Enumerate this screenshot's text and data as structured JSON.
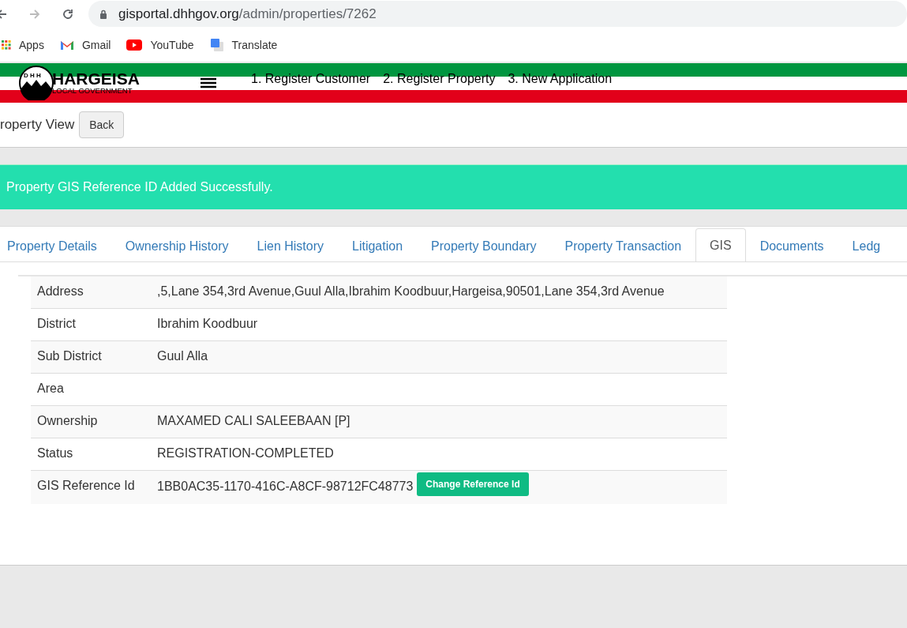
{
  "browser": {
    "url_host": "gisportal.dhhgov.org",
    "url_path": "/admin/properties/7262",
    "bookmarks": [
      {
        "label": "Apps",
        "kind": "apps"
      },
      {
        "label": "Gmail",
        "kind": "gmail"
      },
      {
        "label": "YouTube",
        "kind": "youtube"
      },
      {
        "label": "Translate",
        "kind": "translate"
      }
    ]
  },
  "header": {
    "logo_title": "HARGEISA",
    "logo_subtitle": "LOCAL GOVERNMENT",
    "logo_letters": "D H H",
    "nav": [
      "1. Register Customer",
      "2. Register Property",
      "3. New Application"
    ]
  },
  "page": {
    "title": "roperty View",
    "back_button": "Back"
  },
  "alert": "Property GIS Reference ID Added Successfully.",
  "tabs": [
    {
      "label": "Property Details",
      "selected": false
    },
    {
      "label": "Ownership History",
      "selected": false
    },
    {
      "label": "Lien History",
      "selected": false
    },
    {
      "label": "Litigation",
      "selected": false
    },
    {
      "label": "Property Boundary",
      "selected": false
    },
    {
      "label": "Property Transaction",
      "selected": false
    },
    {
      "label": "GIS",
      "selected": true
    },
    {
      "label": "Documents",
      "selected": false
    },
    {
      "label": "Ledg",
      "selected": false
    }
  ],
  "details": [
    {
      "label": "Address",
      "value": ",5,Lane 354,3rd Avenue,Guul Alla,Ibrahim Koodbuur,Hargeisa,90501,Lane 354,3rd Avenue"
    },
    {
      "label": "District",
      "value": "Ibrahim Koodbuur"
    },
    {
      "label": "Sub District",
      "value": "Guul Alla"
    },
    {
      "label": "Area"
    },
    {
      "label": "Ownership",
      "value": "MAXAMED CALI SALEEBAAN [P]"
    },
    {
      "label": "Status",
      "value": "REGISTRATION-COMPLETED"
    },
    {
      "label": "GIS Reference Id",
      "value": "1BB0AC35-1170-416C-A8CF-98712FC48773",
      "button": "Change Reference Id"
    }
  ]
}
